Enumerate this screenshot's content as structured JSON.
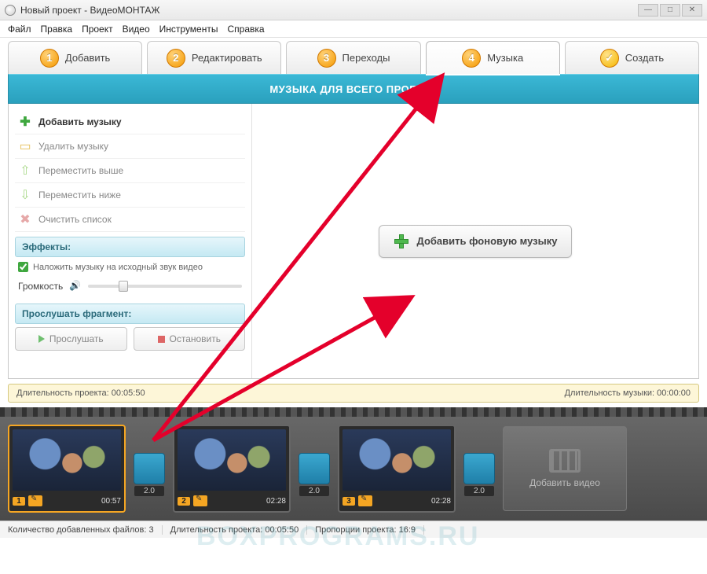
{
  "window": {
    "title": "Новый проект - ВидеоМОНТАЖ"
  },
  "menu": {
    "file": "Файл",
    "edit": "Правка",
    "project": "Проект",
    "video": "Видео",
    "tools": "Инструменты",
    "help": "Справка"
  },
  "tabs": {
    "add": "Добавить",
    "edit_tab": "Редактировать",
    "transitions": "Переходы",
    "music": "Музыка",
    "create": "Создать"
  },
  "banner": "МУЗЫКА ДЛЯ ВСЕГО ПРОЕКТА",
  "sidebar": {
    "add_music": "Добавить музыку",
    "delete_music": "Удалить музыку",
    "move_up": "Переместить выше",
    "move_down": "Переместить ниже",
    "clear_list": "Очистить список",
    "effects_hdr": "Эффекты:",
    "overlay_label": "Наложить музыку на исходный звук видео",
    "volume_label": "Громкость",
    "preview_hdr": "Прослушать фрагмент:",
    "play": "Прослушать",
    "stop": "Остановить"
  },
  "main": {
    "add_bg_music": "Добавить фоновую музыку"
  },
  "duration": {
    "project_label": "Длительность проекта:",
    "project_value": "00:05:50",
    "music_label": "Длительность музыки:",
    "music_value": "00:00:00"
  },
  "timeline": {
    "clips": [
      {
        "idx": "1",
        "time": "00:57"
      },
      {
        "idx": "2",
        "time": "02:28"
      },
      {
        "idx": "3",
        "time": "02:28"
      }
    ],
    "transition_value": "2.0",
    "add_video": "Добавить видео"
  },
  "status": {
    "files_label": "Количество добавленных файлов:",
    "files_value": "3",
    "dur_label": "Длительность проекта:",
    "dur_value": "00:05:50",
    "aspect_label": "Пропорции проекта:",
    "aspect_value": "16:9"
  },
  "watermark": "BOXPROGRAMS.RU"
}
